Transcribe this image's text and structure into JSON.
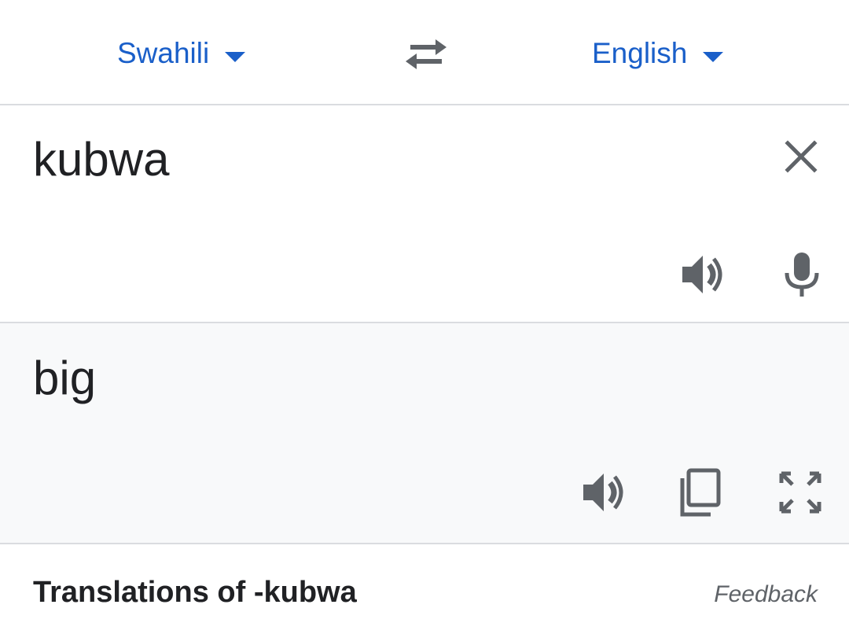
{
  "language_bar": {
    "source_language": "Swahili",
    "target_language": "English",
    "swap_icon": "swap-arrows-icon",
    "dropdown_icon": "caret-down-icon"
  },
  "input": {
    "text": "kubwa",
    "clear_icon": "close-icon",
    "listen_icon": "speaker-icon",
    "mic_icon": "microphone-icon"
  },
  "output": {
    "text": "big",
    "listen_icon": "speaker-icon",
    "copy_icon": "copy-icon",
    "fullscreen_icon": "fullscreen-icon"
  },
  "translations": {
    "heading": "Translations of -kubwa",
    "feedback_label": "Feedback"
  },
  "colors": {
    "accent_blue": "#1a5fc9",
    "icon_gray": "#5f6368",
    "output_background": "#f8f9fa",
    "divider": "#dadce0"
  }
}
